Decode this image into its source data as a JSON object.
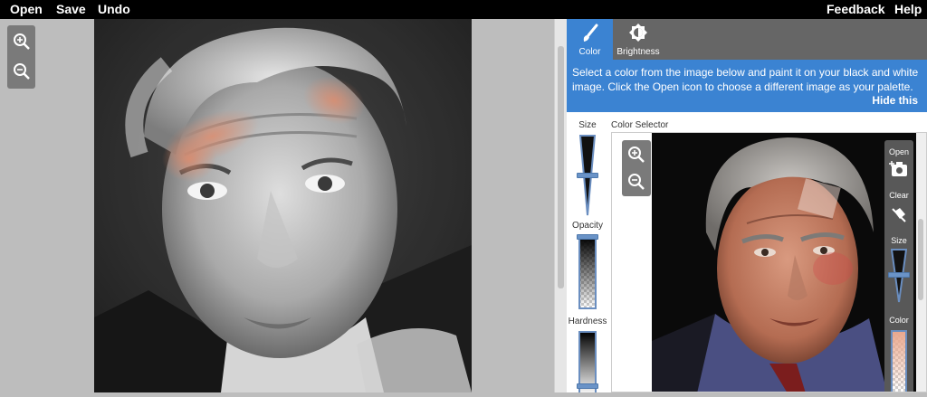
{
  "menu": {
    "open": "Open",
    "save": "Save",
    "undo": "Undo",
    "feedback": "Feedback",
    "help": "Help"
  },
  "tabs": [
    {
      "label": "Color",
      "icon": "paintbrush-icon",
      "active": true
    },
    {
      "label": "Brightness",
      "icon": "brightness-icon",
      "active": false
    }
  ],
  "info": {
    "text": "Select a color from the image below and paint it on your black and white image. Click the Open icon to choose a different image as your palette.",
    "hide_label": "Hide this"
  },
  "brush_tools": {
    "size_label": "Size",
    "opacity_label": "Opacity",
    "hardness_label": "Hardness"
  },
  "color_selector": {
    "label": "Color Selector",
    "tools": {
      "open_label": "Open",
      "clear_label": "Clear",
      "size_label": "Size",
      "color_label": "Color"
    }
  },
  "colors": {
    "topbar": "#000000",
    "accent": "#3b83d2",
    "tab_bg": "#666666",
    "paint": "#e58a68",
    "canvas_bg": "#bdbdbd"
  }
}
